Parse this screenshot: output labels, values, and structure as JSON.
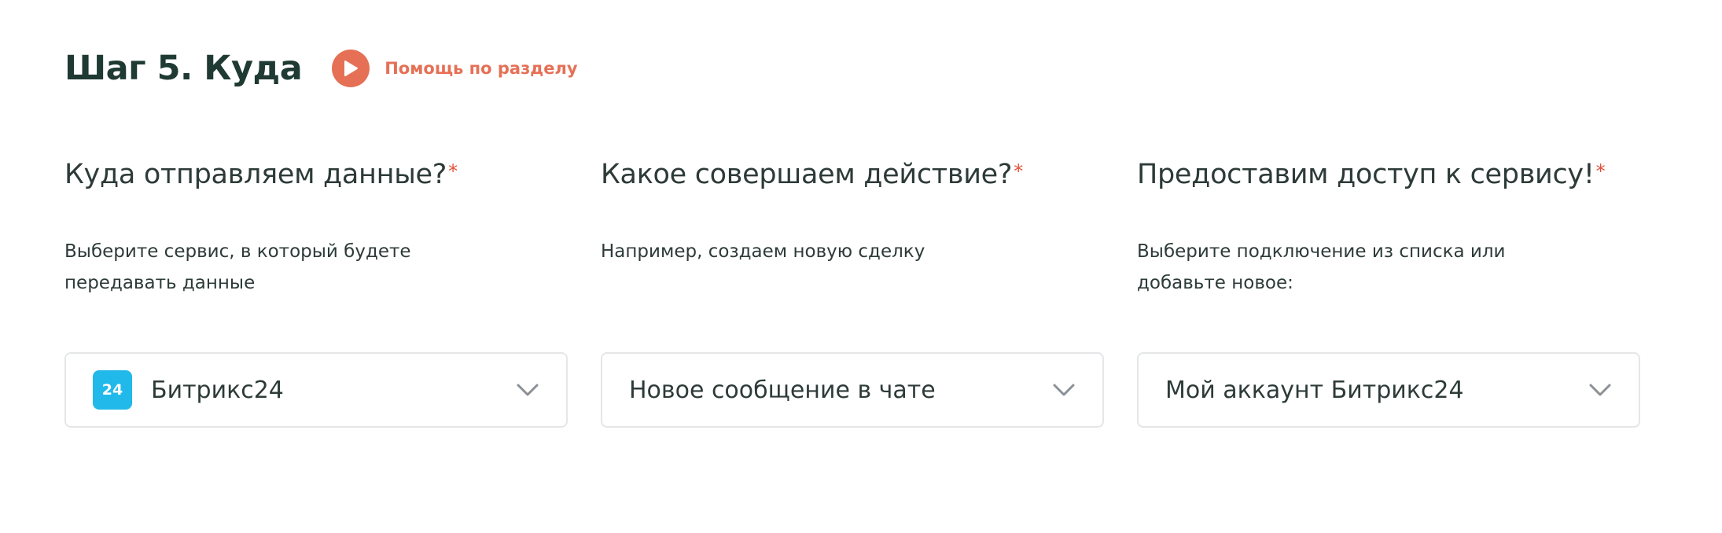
{
  "header": {
    "step_title": "Шаг 5. Куда",
    "help_label": "Помощь по разделу",
    "help_icon": "play-icon",
    "accent_color": "#e57056"
  },
  "columns": [
    {
      "title": "Куда отправляем данные?",
      "required_mark": "*",
      "hint": "Выберите сервис, в который будете передавать данные",
      "select": {
        "value": "Битрикс24",
        "logo_text": "24",
        "logo_color": "#21b9ea",
        "icon": "chevron-down-icon"
      }
    },
    {
      "title": "Какое совершаем действие?",
      "required_mark": "*",
      "hint": "Например, создаем новую сделку",
      "select": {
        "value": "Новое сообщение в чате",
        "icon": "chevron-down-icon"
      }
    },
    {
      "title": "Предоставим доступ к сервису!",
      "required_mark": "*",
      "hint": "Выберите подключение из списка или добавьте новое:",
      "select": {
        "value": "Мой аккаунт Битрикс24",
        "icon": "chevron-down-icon"
      }
    }
  ]
}
